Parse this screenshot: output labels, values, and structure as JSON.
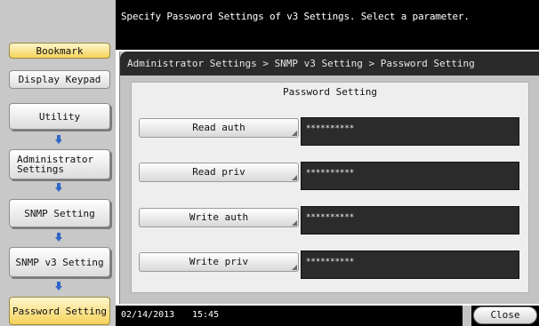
{
  "top_message": "Specify Password Settings of v3 Settings. Select a parameter.",
  "sidebar": {
    "bookmark": "Bookmark",
    "display_keypad": "Display Keypad",
    "utility": "Utility",
    "administrator_settings": "Administrator Settings",
    "snmp_setting": "SNMP Setting",
    "snmp_v3_setting": "SNMP v3 Setting",
    "password_setting": "Password Setting"
  },
  "breadcrumb": "Administrator Settings > SNMP v3 Setting > Password Setting",
  "panel_title": "Password Setting",
  "params": [
    {
      "label": "Read auth",
      "value": "**********"
    },
    {
      "label": "Read priv",
      "value": "**********"
    },
    {
      "label": "Write auth",
      "value": "**********"
    },
    {
      "label": "Write priv",
      "value": "**********"
    }
  ],
  "footer": {
    "date": "02/14/2013",
    "time": "15:45",
    "close": "Close"
  },
  "colors": {
    "accent_yellow": "#f5d25a",
    "arrow_blue": "#2f66c8",
    "value_field_bg": "#2b2b2b"
  }
}
